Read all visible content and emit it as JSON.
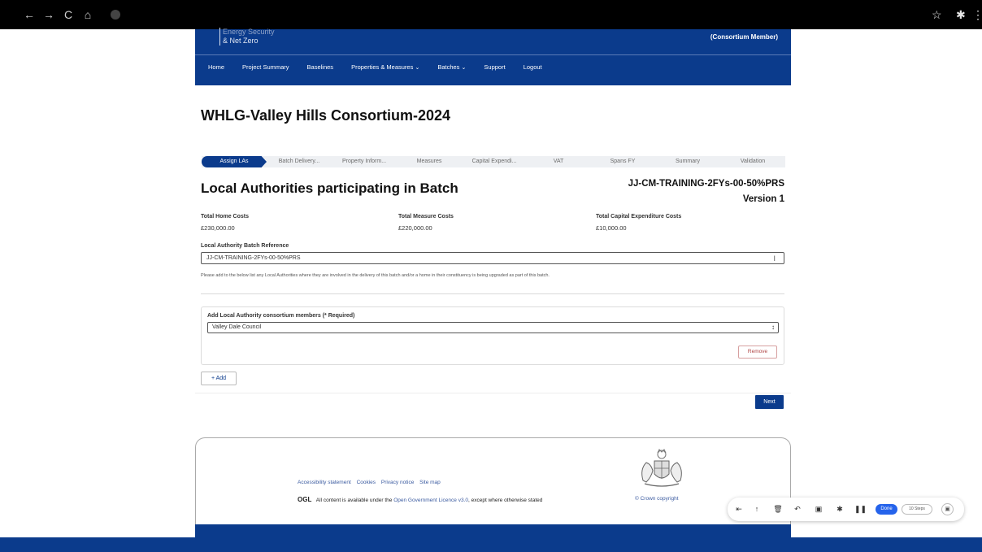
{
  "browser": {
    "back_icon": "←",
    "forward_icon": "→",
    "reload_icon": "C",
    "home_icon": "⌂",
    "bookmark_icon": "☆",
    "extensions_icon": "✱",
    "menu_icon": "⋮"
  },
  "header": {
    "brand_line1": "Energy Security",
    "brand_line2": "& Net Zero",
    "role": "(Consortium Member)",
    "nav": [
      "Home",
      "Project Summary",
      "Baselines",
      "Properties & Measures",
      "Batches",
      "Support",
      "Logout"
    ],
    "nav_dropdown_icon": "⌄"
  },
  "page_title": "WHLG-Valley Hills Consortium-2024",
  "progress_steps": [
    "Assign LAs",
    "Batch Delivery...",
    "Property Inform...",
    "Measures",
    "Capital Expendi...",
    "VAT",
    "Spans FY",
    "Summary",
    "Validation"
  ],
  "section": {
    "title": "Local Authorities participating in Batch",
    "batch_name": "JJ-CM-TRAINING-2FYs-00-50%PRS",
    "version": "Version 1"
  },
  "costs": {
    "home_label": "Total Home Costs",
    "home_value": "£230,000.00",
    "measure_label": "Total Measure Costs",
    "measure_value": "£220,000.00",
    "capex_label": "Total Capital Expenditure Costs",
    "capex_value": "£10,000.00"
  },
  "reference": {
    "label": "Local Authority Batch Reference",
    "value": "JJ-CM-TRAINING-2FYs-00-50%PRS"
  },
  "help_text": "Please add to the below list any Local Authorities where they are involved in the delivery of this batch and/or a home in their constituency is being upgraded as part of this batch.",
  "members": {
    "label": "Add Local Authority consortium members (* Required)",
    "selected": "Valley Dale Council",
    "remove_label": "Remove"
  },
  "add_label": "+ Add",
  "next_label": "Next",
  "footer": {
    "links": [
      "Accessibility statement",
      "Cookies",
      "Privacy notice",
      "Site map"
    ],
    "ogl_logo": "OGL",
    "ogl_text_before": "All content is available under the",
    "ogl_link": "Open Government Licence v3.0",
    "ogl_text_after": ", except where otherwise stated",
    "copyright": "© Crown copyright"
  },
  "recorder": {
    "done_label": "Done",
    "steps_label": "10 Steps"
  }
}
